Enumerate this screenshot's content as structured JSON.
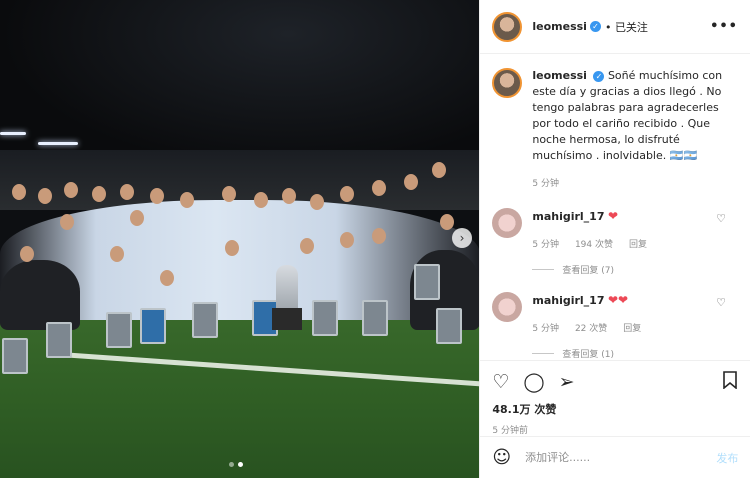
{
  "post": {
    "username": "leomessi",
    "follow_label": "已关注",
    "more_label": "•••",
    "verified_glyph": "✓"
  },
  "caption": {
    "username": "leomessi",
    "text": "Soñé muchísimo con este día y gracias a dios llegó . No tengo palabras para agradecerles por todo el cariño recibido . Que noche hermosa, lo disfruté muchísimo . inolvidable. 🇦🇷🇦🇷",
    "time": "5 分钟"
  },
  "comments": [
    {
      "username": "mahigirl_17",
      "hearts": "❤",
      "time": "5 分钟",
      "likes": "194 次赞",
      "reply": "回复",
      "view_replies": "查看回复 (7)"
    },
    {
      "username": "mahigirl_17",
      "hearts": "❤❤",
      "time": "5 分钟",
      "likes": "22 次赞",
      "reply": "回复",
      "view_replies": "查看回复 (1)"
    }
  ],
  "actions": {
    "likes_count": "48.1万 次赞",
    "posted_ago": "5 分钟前"
  },
  "add_comment": {
    "placeholder": "添加评论......",
    "post_label": "发布"
  },
  "carousel": {
    "next_glyph": "›",
    "current_index": 1,
    "total": 2
  },
  "icons": {
    "like": "heart-icon",
    "comment": "comment-icon",
    "share": "paper-plane-icon",
    "save": "bookmark-icon",
    "emoji": "smiley-icon"
  },
  "colors": {
    "verified": "#3897f0",
    "heart_red": "#ed4956",
    "post_button": "#b2dffc"
  }
}
